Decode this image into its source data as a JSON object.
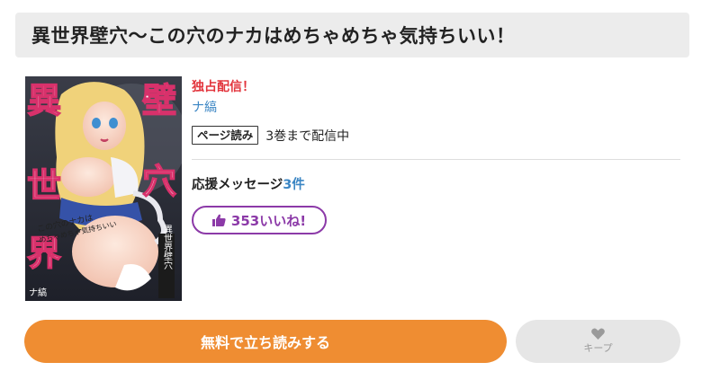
{
  "title": "異世界壁穴〜この穴のナカはめちゃめちゃ気持ちいい！",
  "cover": {
    "title_chars_left": [
      "異",
      "世",
      "界"
    ],
    "title_chars_right": [
      "壁",
      "穴"
    ],
    "speech_text_line1": "この穴のナカは",
    "speech_text_line2": "めちゃめちゃ気持ちいい",
    "spine_text": "異世界壁穴",
    "author_mark": "ナ縞",
    "accent_color": "#d8316b"
  },
  "info": {
    "exclusive_label": "独占配信！",
    "author": "ナ縞",
    "reader_badge": "ページ読み",
    "volumes_text": "3巻まで配信中",
    "support_label": "応援メッセージ",
    "support_count": "3件",
    "likes_label": "353いいね!"
  },
  "actions": {
    "read_button": "無料で立ち読みする",
    "keep_label": "キープ"
  },
  "colors": {
    "primary_orange": "#ef8d32",
    "like_purple": "#8c3aa8",
    "exclusive_red": "#e2343c",
    "link_blue": "#3b86c4"
  }
}
